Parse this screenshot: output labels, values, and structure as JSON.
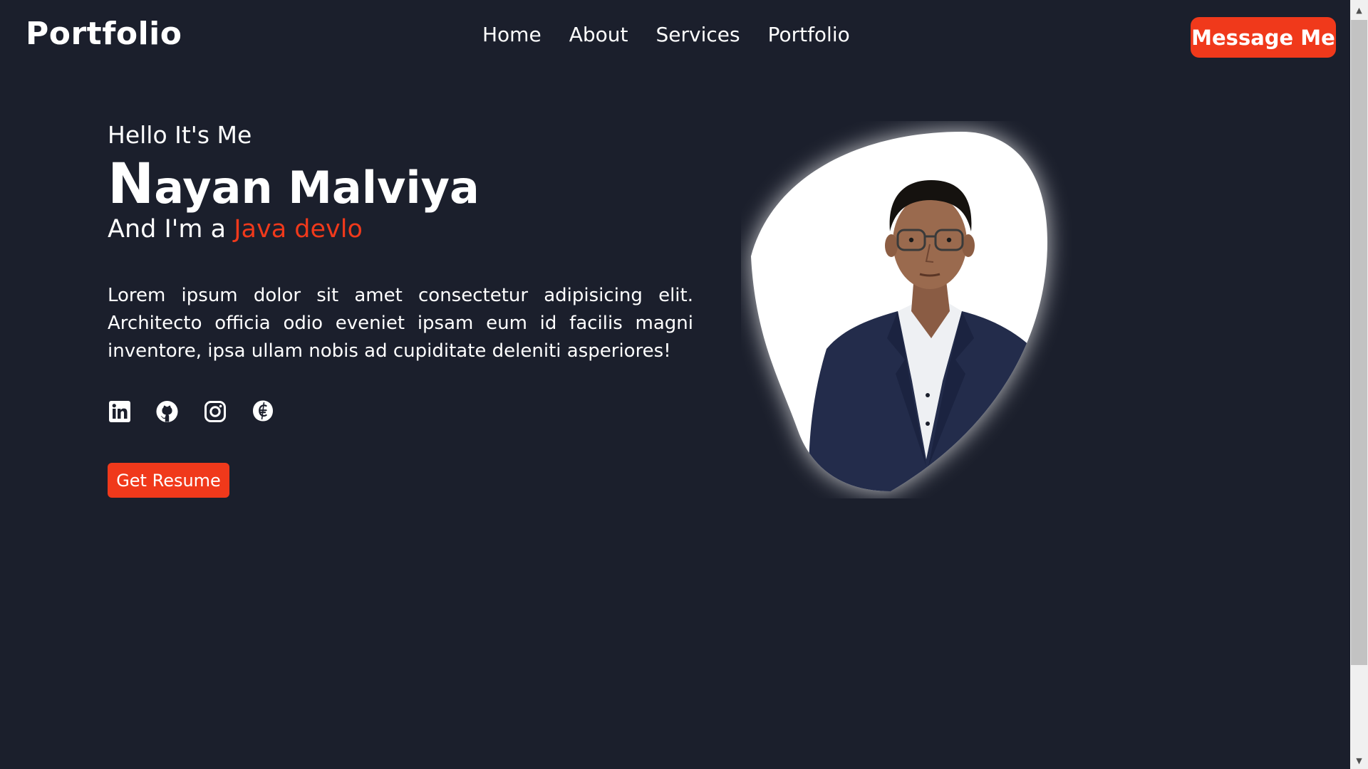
{
  "header": {
    "logo": "Portfolio",
    "nav": [
      "Home",
      "About",
      "Services",
      "Portfolio"
    ],
    "message_button": "Message Me"
  },
  "hero": {
    "greeting": "Hello It's Me",
    "name_first_letter": "N",
    "name_rest": "ayan Malviya",
    "role_prefix": "And I'm a ",
    "role_highlight": "Java devlo",
    "description": "Lorem ipsum dolor sit amet consectetur adipisicing elit. Architecto officia odio eveniet ipsam eum id facilis magni inventore, ipsa ullam nobis ad cupiditate deleniti asperiores!",
    "socials": [
      "linkedin-icon",
      "github-icon",
      "instagram-icon",
      "codechef-icon"
    ],
    "resume_button": "Get Resume"
  },
  "colors": {
    "background": "#1b1f2c",
    "accent": "#f0391b",
    "text": "#ffffff"
  }
}
